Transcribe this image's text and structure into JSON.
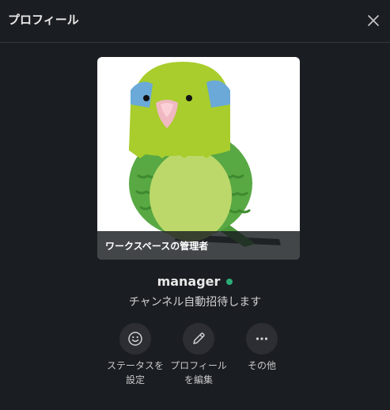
{
  "header": {
    "title": "プロフィール",
    "close_icon": "close-icon"
  },
  "avatar": {
    "caption": "ワークスペースの管理者",
    "image_icon": "parakeet-illustration"
  },
  "profile": {
    "name": "manager",
    "presence": "active",
    "status_text": "チャンネル自動招待します"
  },
  "actions": [
    {
      "label": "ステータスを\n設定",
      "icon": "smiley-icon"
    },
    {
      "label": "プロフィール\nを編集",
      "icon": "pencil-icon"
    },
    {
      "label": "その他",
      "icon": "more-icon"
    }
  ],
  "colors": {
    "background": "#1a1d21",
    "presence_active": "#2bac76",
    "button_bg": "#2c2e33"
  }
}
